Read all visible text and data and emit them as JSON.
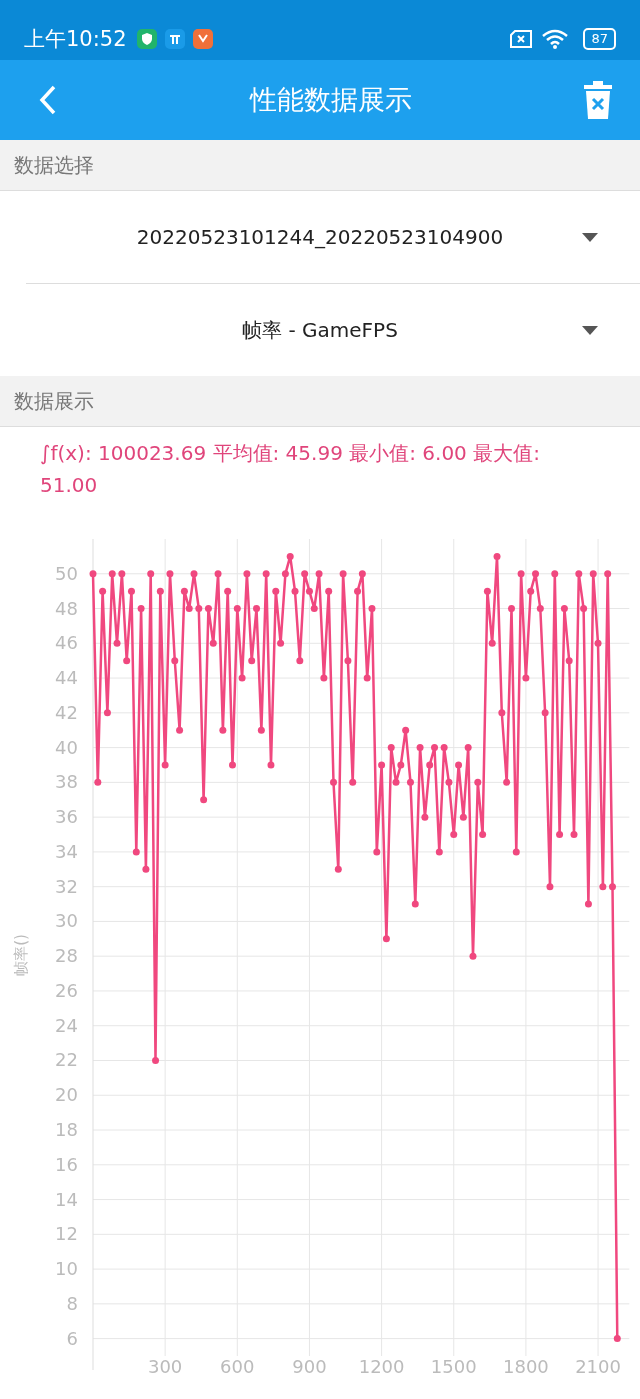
{
  "status_bar": {
    "time": "上午10:52",
    "battery": "87"
  },
  "app_bar": {
    "title": "性能数据展示"
  },
  "sections": [
    {
      "title": "数据选择"
    },
    {
      "title": "数据展示"
    }
  ],
  "dropdowns": [
    {
      "value": "20220523101244_20220523104900"
    },
    {
      "value": "帧率 - GameFPS"
    }
  ],
  "stats": "∫f(x): 100023.69 平均值: 45.99 最小值: 6.00 最大值: 51.00",
  "chart_data": {
    "type": "line",
    "grid": true,
    "ylabel": "帧率()",
    "xlim": [
      0,
      2230
    ],
    "ylim": [
      5,
      52
    ],
    "xticks": [
      300,
      600,
      900,
      1200,
      1500,
      1800,
      2100
    ],
    "yticks": [
      6,
      8,
      10,
      12,
      14,
      16,
      18,
      20,
      22,
      24,
      26,
      28,
      30,
      32,
      34,
      36,
      38,
      40,
      42,
      44,
      46,
      48,
      50
    ],
    "x": [
      0,
      20,
      40,
      60,
      80,
      100,
      120,
      140,
      160,
      180,
      200,
      220,
      240,
      260,
      280,
      300,
      320,
      340,
      360,
      380,
      400,
      420,
      440,
      460,
      480,
      500,
      520,
      540,
      560,
      580,
      600,
      620,
      640,
      660,
      680,
      700,
      720,
      740,
      760,
      780,
      800,
      820,
      840,
      860,
      880,
      900,
      920,
      940,
      960,
      980,
      1000,
      1020,
      1040,
      1060,
      1080,
      1100,
      1120,
      1140,
      1160,
      1180,
      1200,
      1220,
      1240,
      1260,
      1280,
      1300,
      1320,
      1340,
      1360,
      1380,
      1400,
      1420,
      1440,
      1460,
      1480,
      1500,
      1520,
      1540,
      1560,
      1580,
      1600,
      1620,
      1640,
      1660,
      1680,
      1700,
      1720,
      1740,
      1760,
      1780,
      1800,
      1820,
      1840,
      1860,
      1880,
      1900,
      1920,
      1940,
      1960,
      1980,
      2000,
      2020,
      2040,
      2060,
      2080,
      2100,
      2120,
      2140,
      2160,
      2180
    ],
    "series": [
      {
        "color": "#f0487f",
        "marker": "circle",
        "values": [
          50,
          38,
          49,
          42,
          50,
          46,
          50,
          45,
          49,
          34,
          48,
          33,
          50,
          22,
          49,
          39,
          50,
          45,
          41,
          49,
          48,
          50,
          48,
          37,
          48,
          46,
          50,
          41,
          49,
          39,
          48,
          44,
          50,
          45,
          48,
          41,
          50,
          39,
          49,
          46,
          50,
          51,
          49,
          45,
          50,
          49,
          48,
          50,
          44,
          49,
          38,
          33,
          50,
          45,
          38,
          49,
          50,
          44,
          48,
          34,
          39,
          29,
          40,
          38,
          39,
          41,
          38,
          31,
          40,
          36,
          39,
          40,
          34,
          40,
          38,
          35,
          39,
          36,
          40,
          28,
          38,
          35,
          49,
          46,
          51,
          42,
          38,
          48,
          34,
          50,
          44,
          49,
          50,
          48,
          42,
          32,
          50,
          35,
          48,
          45,
          35,
          50,
          48,
          31,
          50,
          46,
          32,
          50,
          32,
          6
        ]
      }
    ]
  }
}
